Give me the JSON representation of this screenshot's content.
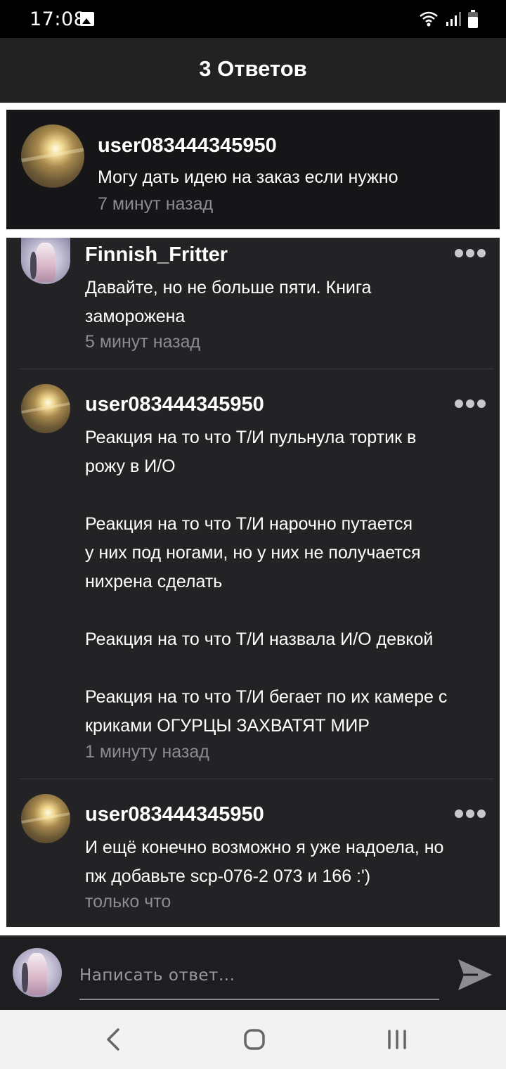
{
  "status_bar": {
    "time": "17:08",
    "icons": [
      "image-icon",
      "wifi-icon",
      "signal-icon",
      "battery-icon"
    ]
  },
  "header": {
    "title": "3 Ответов"
  },
  "parent_comment": {
    "username": "user083444345950",
    "text": "Могу дать идею на заказ если нужно",
    "time": "7 минут назад",
    "avatar": "sunset-avatar"
  },
  "replies": [
    {
      "username": "Finnish_Fritter",
      "text": "Давайте, но не больше пяти. Книга\nзаморожена",
      "time": "5 минут назад",
      "avatar": "anime-avatar"
    },
    {
      "username": "user083444345950",
      "text": "Реакция на то что Т/И пульнула тортик в\nрожу в И/О\n\nРеакция на то что Т/И нарочно путается\nу них под ногами, но у них не получается\nнихрена сделать\n\nРеакция на то что Т/И назвала И/О девкой\n\nРеакция на то что Т/И бегает по их камере с\nкриками ОГУРЦЫ ЗАХВАТЯТ МИР",
      "time": "1 минуту назад",
      "avatar": "sunset-avatar"
    },
    {
      "username": "user083444345950",
      "text": "И ещё конечно возможно я уже надоела, но\nпж добавьте scp-076-2 073 и 166 :')",
      "time": "только что",
      "avatar": "sunset-avatar"
    }
  ],
  "composer": {
    "placeholder": "Написать ответ..."
  },
  "navbar": {
    "buttons": [
      "back-icon",
      "home-icon",
      "recents-icon"
    ]
  },
  "colors": {
    "background": "#232326",
    "header": "#222222",
    "highlight_border": "#ffffff",
    "muted_text": "#8c8c90"
  }
}
